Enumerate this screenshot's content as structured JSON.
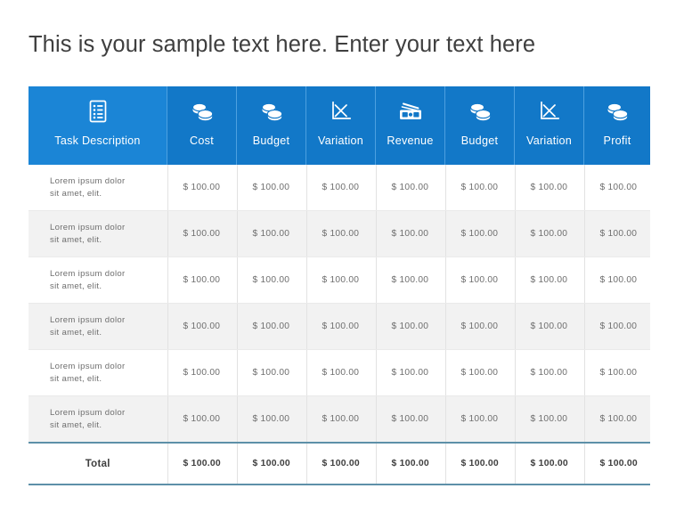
{
  "slide": {
    "title": "This is your sample text here. Enter your text here"
  },
  "table": {
    "columns": [
      {
        "label": "Task Description",
        "icon": "document-list-icon"
      },
      {
        "label": "Cost",
        "icon": "coins-icon"
      },
      {
        "label": "Budget",
        "icon": "coins-icon"
      },
      {
        "label": "Variation",
        "icon": "line-chart-icon"
      },
      {
        "label": "Revenue",
        "icon": "money-bill-icon"
      },
      {
        "label": "Budget",
        "icon": "coins-icon"
      },
      {
        "label": "Variation",
        "icon": "line-chart-icon"
      },
      {
        "label": "Profit",
        "icon": "coins-icon"
      }
    ],
    "rows": [
      {
        "desc_line1": "Lorem ipsum dolor",
        "desc_line2": "sit amet, elit.",
        "values": [
          "$ 100.00",
          "$ 100.00",
          "$ 100.00",
          "$ 100.00",
          "$ 100.00",
          "$ 100.00",
          "$ 100.00"
        ]
      },
      {
        "desc_line1": "Lorem ipsum dolor",
        "desc_line2": "sit amet, elit.",
        "values": [
          "$ 100.00",
          "$ 100.00",
          "$ 100.00",
          "$ 100.00",
          "$ 100.00",
          "$ 100.00",
          "$ 100.00"
        ]
      },
      {
        "desc_line1": "Lorem ipsum dolor",
        "desc_line2": "sit amet, elit.",
        "values": [
          "$ 100.00",
          "$ 100.00",
          "$ 100.00",
          "$ 100.00",
          "$ 100.00",
          "$ 100.00",
          "$ 100.00"
        ]
      },
      {
        "desc_line1": "Lorem ipsum dolor",
        "desc_line2": "sit amet, elit.",
        "values": [
          "$ 100.00",
          "$ 100.00",
          "$ 100.00",
          "$ 100.00",
          "$ 100.00",
          "$ 100.00",
          "$ 100.00"
        ]
      },
      {
        "desc_line1": "Lorem ipsum dolor",
        "desc_line2": "sit amet, elit.",
        "values": [
          "$ 100.00",
          "$ 100.00",
          "$ 100.00",
          "$ 100.00",
          "$ 100.00",
          "$ 100.00",
          "$ 100.00"
        ]
      },
      {
        "desc_line1": "Lorem ipsum dolor",
        "desc_line2": "sit amet, elit.",
        "values": [
          "$ 100.00",
          "$ 100.00",
          "$ 100.00",
          "$ 100.00",
          "$ 100.00",
          "$ 100.00",
          "$ 100.00"
        ]
      }
    ],
    "total": {
      "label": "Total",
      "values": [
        "$ 100.00",
        "$ 100.00",
        "$ 100.00",
        "$ 100.00",
        "$ 100.00",
        "$ 100.00",
        "$ 100.00"
      ]
    }
  },
  "colors": {
    "header_blue": "#1278c8",
    "header_blue_first": "#1b85d6",
    "header_divider": "#4da0e0",
    "total_rule": "#5d90a8",
    "alt_row": "#f2f2f2",
    "title_text": "#3f3f3f",
    "body_text": "#6f6f6f"
  }
}
